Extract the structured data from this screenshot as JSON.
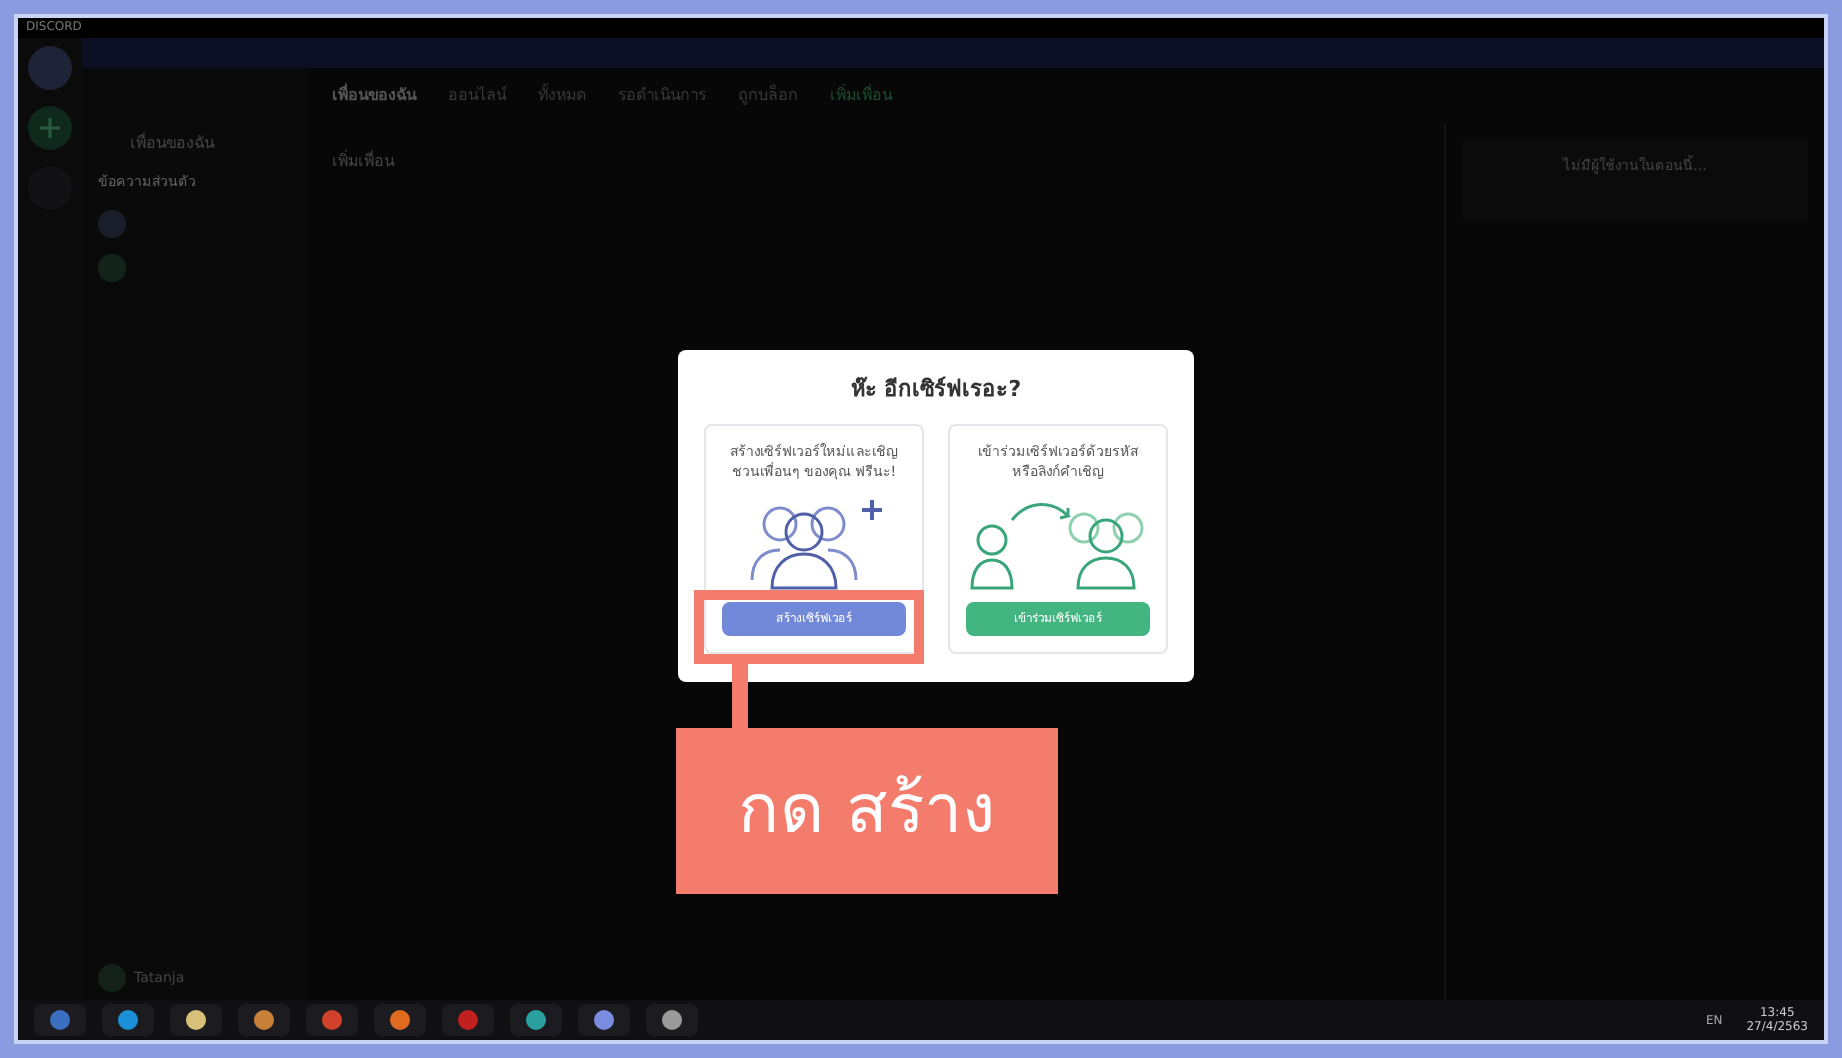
{
  "window": {
    "title": "DISCORD"
  },
  "sidebar": {
    "friends_item": "เพื่อนของฉัน",
    "section": "ข้อความส่วนตัว",
    "user": {
      "name": "Tatanja"
    }
  },
  "tabs": [
    {
      "label": "เพื่อนของฉัน",
      "selected": true
    },
    {
      "label": "ออนไลน์",
      "selected": false
    },
    {
      "label": "ทั้งหมด",
      "selected": false
    },
    {
      "label": "รอดำเนินการ",
      "selected": false
    },
    {
      "label": "ถูกบล็อก",
      "selected": false
    },
    {
      "label": "เพิ่มเพื่อน",
      "selected": false
    }
  ],
  "content": {
    "heading": "เพิ่มเพื่อน"
  },
  "activity": {
    "title": "ไม่มีผู้ใช้งานในตอนนี้..."
  },
  "modal": {
    "title": "ห๊ะ อีกเซิร์ฟเรอะ?",
    "options": [
      {
        "kind": "create",
        "text": "สร้างเซิร์ฟเวอร์ใหม่และเชิญชวนเพื่อนๆ ของคุณ ฟรีนะ!",
        "button": "สร้างเซิร์ฟเวอร์"
      },
      {
        "kind": "join",
        "text": "เข้าร่วมเซิร์ฟเวอร์ด้วยรหัสหรือลิงก์คำเชิญ",
        "button": "เข้าร่วมเซิร์ฟเวอร์"
      }
    ]
  },
  "annotation": {
    "label": "กด สร้าง"
  },
  "taskbar": {
    "language": "EN",
    "time": "13:45",
    "date": "27/4/2563"
  }
}
